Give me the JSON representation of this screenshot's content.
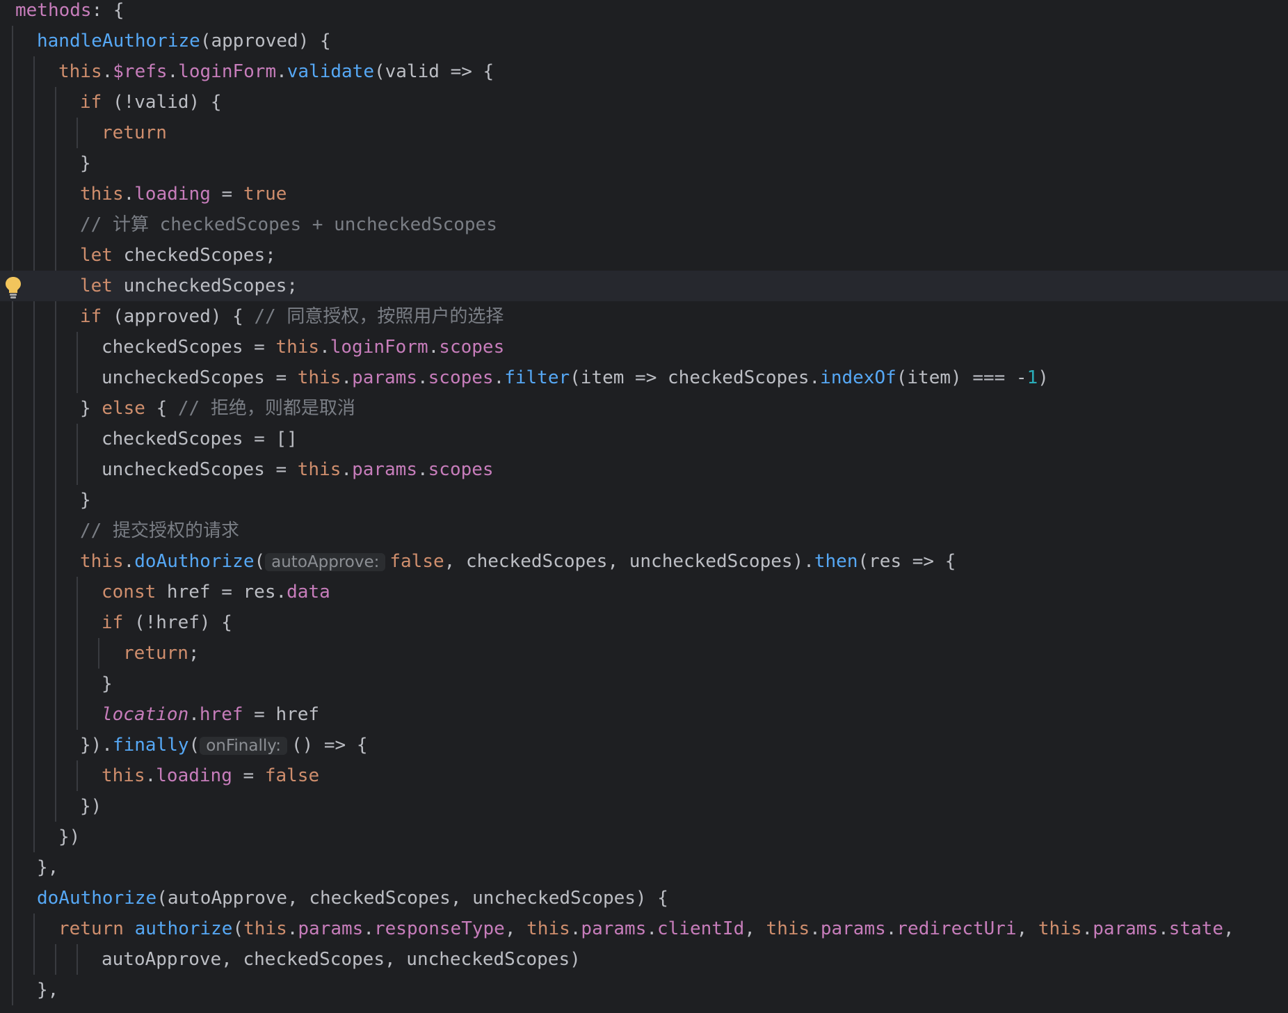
{
  "colors": {
    "background": "#1e1f22",
    "current_line": "#26282e",
    "keyword": "#cf8e6d",
    "function": "#56a8f5",
    "property": "#c77dbb",
    "plain": "#bcbec4",
    "number": "#2aacb8",
    "comment": "#7a7e85",
    "inlay_hint_bg": "#2b2d30",
    "inlay_hint_text": "#8c8f94",
    "indent_guide": "#393b40",
    "bulb": "#f2c55c"
  },
  "gutter": {
    "icon": "lightbulb-icon"
  },
  "code": {
    "lines": [
      {
        "indent": 0,
        "tokens": [
          [
            "prop",
            "methods"
          ],
          [
            "punc",
            ": {"
          ]
        ]
      },
      {
        "indent": 1,
        "tokens": [
          [
            "fn",
            "handleAuthorize"
          ],
          [
            "punc",
            "(approved) {"
          ]
        ]
      },
      {
        "indent": 2,
        "tokens": [
          [
            "kw",
            "this"
          ],
          [
            "punc",
            "."
          ],
          [
            "prop",
            "$refs"
          ],
          [
            "punc",
            "."
          ],
          [
            "prop",
            "loginForm"
          ],
          [
            "punc",
            "."
          ],
          [
            "fn",
            "validate"
          ],
          [
            "punc",
            "(valid => {"
          ]
        ]
      },
      {
        "indent": 3,
        "tokens": [
          [
            "kw",
            "if"
          ],
          [
            "punc",
            " (!valid) {"
          ]
        ]
      },
      {
        "indent": 4,
        "tokens": [
          [
            "kw",
            "return"
          ]
        ]
      },
      {
        "indent": 3,
        "tokens": [
          [
            "punc",
            "}"
          ]
        ]
      },
      {
        "indent": 3,
        "tokens": [
          [
            "kw",
            "this"
          ],
          [
            "punc",
            "."
          ],
          [
            "prop",
            "loading"
          ],
          [
            "punc",
            " = "
          ],
          [
            "kw",
            "true"
          ]
        ]
      },
      {
        "indent": 3,
        "tokens": [
          [
            "cm",
            "// 计算 checkedScopes + uncheckedScopes"
          ]
        ]
      },
      {
        "indent": 3,
        "tokens": [
          [
            "kw",
            "let"
          ],
          [
            "id",
            " checkedScopes;"
          ]
        ]
      },
      {
        "indent": 3,
        "current": true,
        "tokens": [
          [
            "kw",
            "let"
          ],
          [
            "id",
            " uncheckedScopes;"
          ]
        ]
      },
      {
        "indent": 3,
        "tokens": [
          [
            "kw",
            "if"
          ],
          [
            "punc",
            " (approved) { "
          ],
          [
            "cm",
            "// 同意授权，按照用户的选择"
          ]
        ]
      },
      {
        "indent": 4,
        "tokens": [
          [
            "id",
            "checkedScopes"
          ],
          [
            "punc",
            " = "
          ],
          [
            "kw",
            "this"
          ],
          [
            "punc",
            "."
          ],
          [
            "prop",
            "loginForm"
          ],
          [
            "punc",
            "."
          ],
          [
            "prop",
            "scopes"
          ]
        ]
      },
      {
        "indent": 4,
        "tokens": [
          [
            "id",
            "uncheckedScopes"
          ],
          [
            "punc",
            " = "
          ],
          [
            "kw",
            "this"
          ],
          [
            "punc",
            "."
          ],
          [
            "prop",
            "params"
          ],
          [
            "punc",
            "."
          ],
          [
            "prop",
            "scopes"
          ],
          [
            "punc",
            "."
          ],
          [
            "fn",
            "filter"
          ],
          [
            "punc",
            "(item => checkedScopes."
          ],
          [
            "fn",
            "indexOf"
          ],
          [
            "punc",
            "(item) === -"
          ],
          [
            "num",
            "1"
          ],
          [
            "punc",
            ")"
          ]
        ]
      },
      {
        "indent": 3,
        "tokens": [
          [
            "punc",
            "} "
          ],
          [
            "kw",
            "else"
          ],
          [
            "punc",
            " { "
          ],
          [
            "cm",
            "// 拒绝，则都是取消"
          ]
        ]
      },
      {
        "indent": 4,
        "tokens": [
          [
            "id",
            "checkedScopes"
          ],
          [
            "punc",
            " = []"
          ]
        ]
      },
      {
        "indent": 4,
        "tokens": [
          [
            "id",
            "uncheckedScopes"
          ],
          [
            "punc",
            " = "
          ],
          [
            "kw",
            "this"
          ],
          [
            "punc",
            "."
          ],
          [
            "prop",
            "params"
          ],
          [
            "punc",
            "."
          ],
          [
            "prop",
            "scopes"
          ]
        ]
      },
      {
        "indent": 3,
        "tokens": [
          [
            "punc",
            "}"
          ]
        ]
      },
      {
        "indent": 3,
        "tokens": [
          [
            "cm",
            "// 提交授权的请求"
          ]
        ]
      },
      {
        "indent": 3,
        "tokens": [
          [
            "kw",
            "this"
          ],
          [
            "punc",
            "."
          ],
          [
            "fn",
            "doAuthorize"
          ],
          [
            "punc",
            "("
          ],
          [
            "hint",
            "autoApprove:"
          ],
          [
            "kw",
            "false"
          ],
          [
            "punc",
            ", checkedScopes, uncheckedScopes)."
          ],
          [
            "fn",
            "then"
          ],
          [
            "punc",
            "(res => {"
          ]
        ]
      },
      {
        "indent": 4,
        "tokens": [
          [
            "kw",
            "const"
          ],
          [
            "id",
            " href"
          ],
          [
            "punc",
            " = res."
          ],
          [
            "prop",
            "data"
          ]
        ]
      },
      {
        "indent": 4,
        "tokens": [
          [
            "kw",
            "if"
          ],
          [
            "punc",
            " (!href) {"
          ]
        ]
      },
      {
        "indent": 5,
        "tokens": [
          [
            "kw",
            "return"
          ],
          [
            "punc",
            ";"
          ]
        ]
      },
      {
        "indent": 4,
        "tokens": [
          [
            "punc",
            "}"
          ]
        ]
      },
      {
        "indent": 4,
        "tokens": [
          [
            "global",
            "location"
          ],
          [
            "punc",
            "."
          ],
          [
            "prop",
            "href"
          ],
          [
            "punc",
            " = href"
          ]
        ]
      },
      {
        "indent": 3,
        "tokens": [
          [
            "punc",
            "})."
          ],
          [
            "fn",
            "finally"
          ],
          [
            "punc",
            "("
          ],
          [
            "hint",
            "onFinally:"
          ],
          [
            "punc",
            "() => {"
          ]
        ]
      },
      {
        "indent": 4,
        "tokens": [
          [
            "kw",
            "this"
          ],
          [
            "punc",
            "."
          ],
          [
            "prop",
            "loading"
          ],
          [
            "punc",
            " = "
          ],
          [
            "kw",
            "false"
          ]
        ]
      },
      {
        "indent": 3,
        "tokens": [
          [
            "punc",
            "})"
          ]
        ]
      },
      {
        "indent": 2,
        "tokens": [
          [
            "punc",
            "})"
          ]
        ]
      },
      {
        "indent": 1,
        "tokens": [
          [
            "punc",
            "},"
          ]
        ]
      },
      {
        "indent": 1,
        "tokens": [
          [
            "fn",
            "doAuthorize"
          ],
          [
            "punc",
            "(autoApprove, checkedScopes, uncheckedScopes) {"
          ]
        ]
      },
      {
        "indent": 2,
        "tokens": [
          [
            "kw",
            "return"
          ],
          [
            "punc",
            " "
          ],
          [
            "fn",
            "authorize"
          ],
          [
            "punc",
            "("
          ],
          [
            "kw",
            "this"
          ],
          [
            "punc",
            "."
          ],
          [
            "prop",
            "params"
          ],
          [
            "punc",
            "."
          ],
          [
            "prop",
            "responseType"
          ],
          [
            "punc",
            ", "
          ],
          [
            "kw",
            "this"
          ],
          [
            "punc",
            "."
          ],
          [
            "prop",
            "params"
          ],
          [
            "punc",
            "."
          ],
          [
            "prop",
            "clientId"
          ],
          [
            "punc",
            ", "
          ],
          [
            "kw",
            "this"
          ],
          [
            "punc",
            "."
          ],
          [
            "prop",
            "params"
          ],
          [
            "punc",
            "."
          ],
          [
            "prop",
            "redirectUri"
          ],
          [
            "punc",
            ", "
          ],
          [
            "kw",
            "this"
          ],
          [
            "punc",
            "."
          ],
          [
            "prop",
            "params"
          ],
          [
            "punc",
            "."
          ],
          [
            "prop",
            "state"
          ],
          [
            "punc",
            ","
          ]
        ]
      },
      {
        "indent": 4,
        "tokens": [
          [
            "id",
            "autoApprove, checkedScopes, uncheckedScopes)"
          ]
        ]
      },
      {
        "indent": 1,
        "tokens": [
          [
            "punc",
            "},"
          ]
        ]
      }
    ]
  }
}
